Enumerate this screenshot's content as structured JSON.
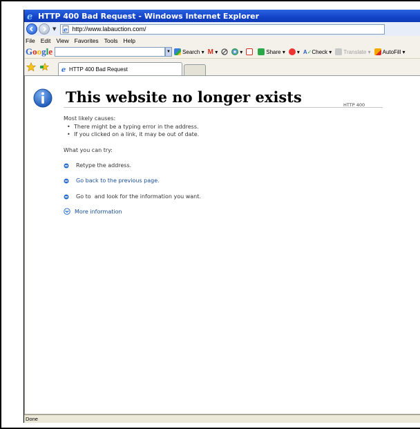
{
  "window": {
    "title": "HTTP 400 Bad Request - Windows Internet Explorer"
  },
  "address_bar": {
    "url": "http://www.labauction.com/"
  },
  "menu": [
    "File",
    "Edit",
    "View",
    "Favorites",
    "Tools",
    "Help"
  ],
  "google_toolbar": {
    "logo": "Google",
    "search": "Search",
    "share": "Share",
    "check": "Check",
    "translate": "Translate",
    "autofill": "AutoFill"
  },
  "tab": {
    "active_title": "HTTP 400 Bad Request"
  },
  "page": {
    "heading": "This website no longer exists",
    "http_code": "HTTP 400",
    "causes_label": "Most likely causes:",
    "causes": [
      "There might be a typing error in the address.",
      "If you clicked on a link, it may be out of date."
    ],
    "try_label": "What you can try:",
    "actions": [
      {
        "text": "Retype the address.",
        "link": false
      },
      {
        "text": "Go back to the previous page.",
        "link": true
      },
      {
        "text": "Go to  and look for the information you want.",
        "link": false
      }
    ],
    "more_info": "More information"
  },
  "status_bar": {
    "text": "Done"
  },
  "colors": {
    "title_bar": "#1343c8",
    "link": "#1a4f96",
    "info_icon": "#1d59b8"
  },
  "icons": [
    "ie-logo-icon",
    "back-arrow-icon",
    "forward-arrow-icon",
    "page-icon",
    "favorites-star-icon",
    "add-favorites-icon",
    "info-icon",
    "blue-bullet-icon",
    "expand-chevron-icon"
  ]
}
